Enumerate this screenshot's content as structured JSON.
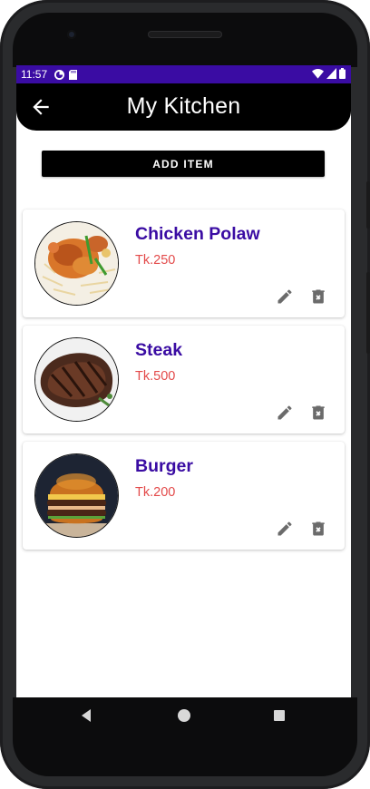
{
  "status": {
    "time": "11:57",
    "bar_color": "#3a0ca3",
    "left_icons": [
      "data-saver-icon",
      "sd-card-icon"
    ],
    "right_icons": [
      "wifi-icon",
      "signal-icon",
      "battery-icon"
    ]
  },
  "appbar": {
    "title": "My Kitchen",
    "back_icon": "arrow-left-icon"
  },
  "actions": {
    "add_item_label": "ADD ITEM"
  },
  "items": [
    {
      "name": "Chicken Polaw",
      "price": "Tk.250",
      "image": "chicken-polaw-photo"
    },
    {
      "name": "Steak",
      "price": "Tk.500",
      "image": "steak-photo"
    },
    {
      "name": "Burger",
      "price": "Tk.200",
      "image": "burger-photo"
    }
  ],
  "colors": {
    "accent": "#3a0ca3",
    "price": "#e34a4a",
    "appbar": "#000000",
    "icon_grey": "#6b6b6b"
  },
  "navbar": {
    "icons": [
      "nav-back-icon",
      "nav-home-icon",
      "nav-recents-icon"
    ]
  }
}
